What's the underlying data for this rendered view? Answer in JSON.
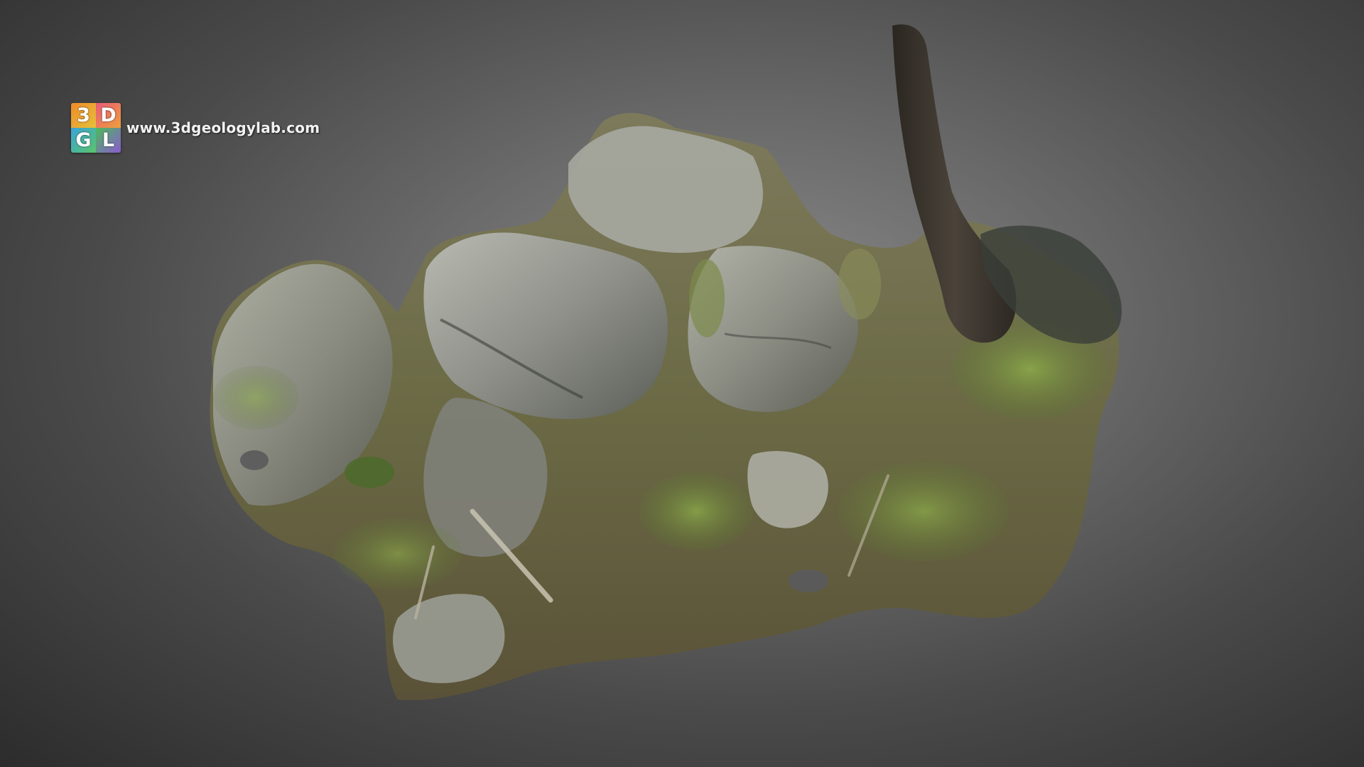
{
  "watermark": {
    "logo_text": "3DGL",
    "url": "www.3dgeologylab.com"
  },
  "colors": {
    "background_center": "#8a8a8a",
    "background_edge": "#2c2c2c",
    "rock": "#9a9c94",
    "moss": "#6f8a3c",
    "soil": "#6e5f44",
    "tree_trunk": "#3a342c"
  },
  "scene": {
    "subject": "photogrammetry model of a mossy rock outcrop with a tree trunk"
  }
}
